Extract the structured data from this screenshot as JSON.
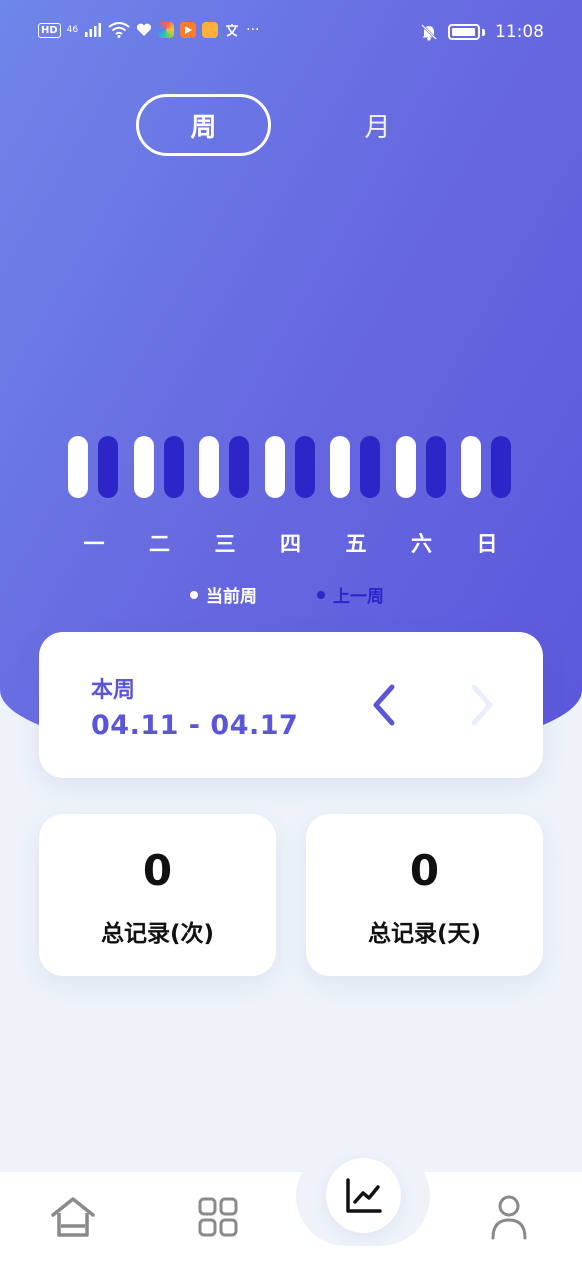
{
  "status_bar": {
    "hd": "HD",
    "network": "46",
    "more": "···",
    "time": "11:08"
  },
  "tabs": {
    "week": "周",
    "month": "月",
    "selected": "week"
  },
  "chart_data": {
    "type": "bar",
    "categories": [
      "一",
      "二",
      "三",
      "四",
      "五",
      "六",
      "日"
    ],
    "series": [
      {
        "name": "当前周",
        "values": [
          0,
          0,
          0,
          0,
          0,
          0,
          0
        ]
      },
      {
        "name": "上一周",
        "values": [
          0,
          0,
          0,
          0,
          0,
          0,
          0
        ]
      }
    ],
    "colors": {
      "current": "#ffffff",
      "previous": "#2d25c7"
    },
    "legend_position": "bottom"
  },
  "legend": {
    "current": "当前周",
    "previous": "上一周"
  },
  "week_card": {
    "title": "本周",
    "range": "04.11 - 04.17"
  },
  "stats": {
    "records_count": {
      "value": "0",
      "label": "总记录(次)"
    },
    "records_days": {
      "value": "0",
      "label": "总记录(天)"
    }
  },
  "bottom_nav": {
    "items": [
      {
        "icon": "home-icon"
      },
      {
        "icon": "grid-icon"
      },
      {
        "icon": "chart-icon",
        "active": true
      },
      {
        "icon": "person-icon"
      }
    ]
  },
  "colors": {
    "accent": "#5a56d6",
    "gradient_start": "#6f86ea",
    "gradient_end": "#5b57db",
    "previous_week": "#2d25c7"
  }
}
